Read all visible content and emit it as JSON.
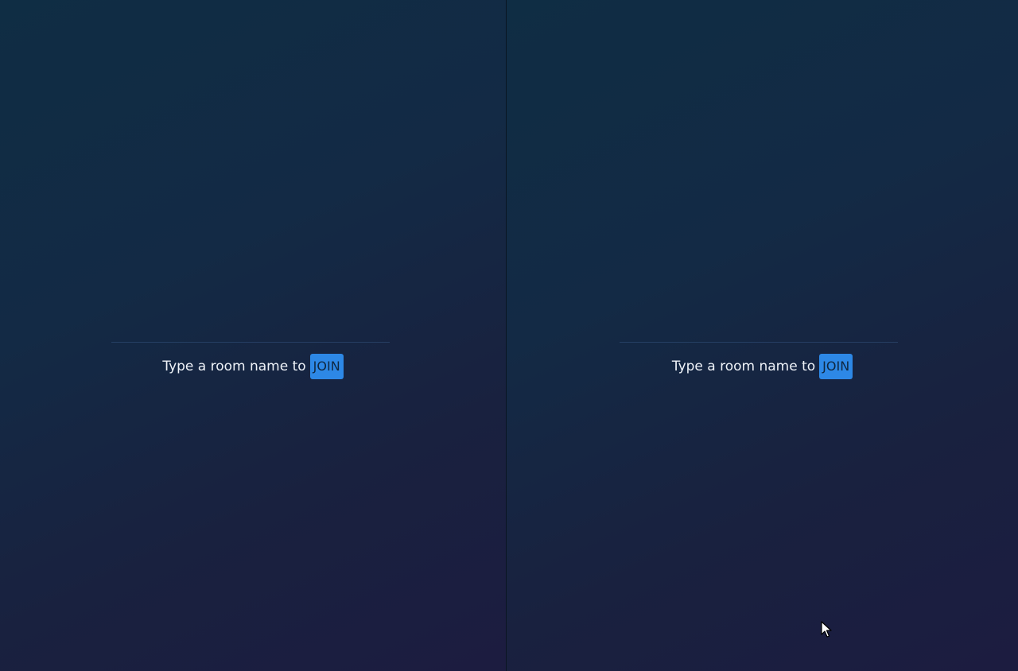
{
  "panes": [
    {
      "room_input": {
        "value": "",
        "placeholder": ""
      },
      "prompt_text": "Type a room name to",
      "join_label": "JOIN"
    },
    {
      "room_input": {
        "value": "",
        "placeholder": ""
      },
      "prompt_text": "Type a room name to",
      "join_label": "JOIN"
    }
  ],
  "colors": {
    "background_top": "#0f2d44",
    "background_bottom": "#1c1c40",
    "accent": "#2d88e6",
    "text": "#eef2f8"
  },
  "icons": [
    "mouse-pointer-icon"
  ]
}
